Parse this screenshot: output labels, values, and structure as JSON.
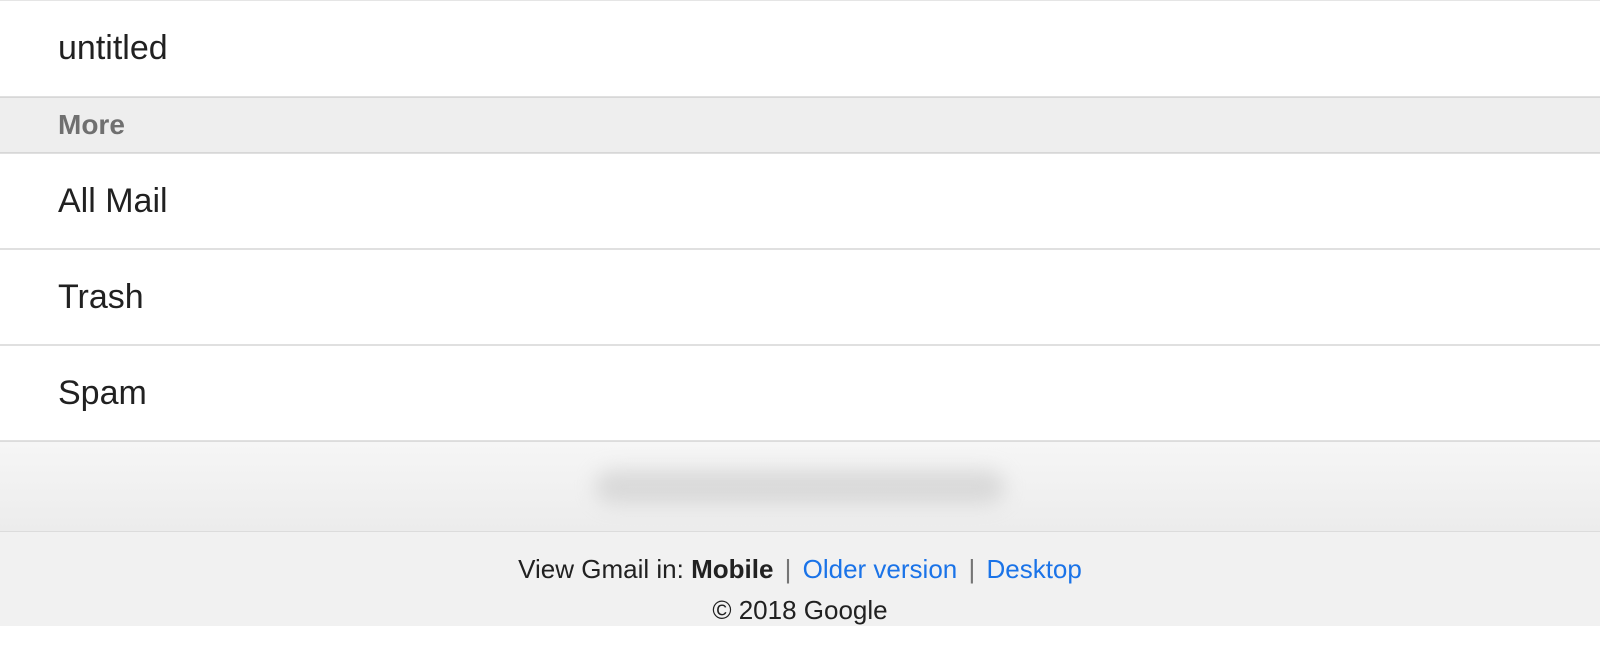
{
  "labels": {
    "untitled": "untitled"
  },
  "sections": {
    "more_header": "More"
  },
  "more_items": [
    {
      "label": "All Mail"
    },
    {
      "label": "Trash"
    },
    {
      "label": "Spam"
    }
  ],
  "footer": {
    "view_prefix": "View Gmail in: ",
    "mobile": "Mobile",
    "older_version": "Older version",
    "desktop": "Desktop",
    "copyright": "© 2018 Google"
  }
}
